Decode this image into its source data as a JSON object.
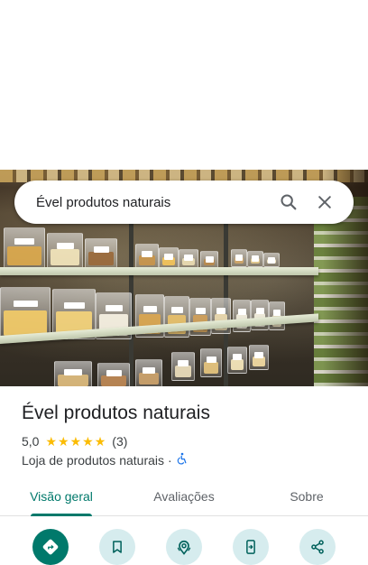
{
  "search": {
    "query": "Ével produtos naturais"
  },
  "place": {
    "name": "Ével produtos naturais",
    "rating": "5,0",
    "stars": 5,
    "review_count": "(3)",
    "category": "Loja de produtos naturais",
    "separator": "·",
    "accessibility_icon": "wheelchair-icon"
  },
  "tabs": [
    {
      "label": "Visão geral",
      "active": true
    },
    {
      "label": "Avaliações",
      "active": false
    },
    {
      "label": "Sobre",
      "active": false
    }
  ],
  "actions": [
    {
      "icon": "directions-icon",
      "primary": true
    },
    {
      "icon": "bookmark-icon",
      "primary": false
    },
    {
      "icon": "nearby-icon",
      "primary": false
    },
    {
      "icon": "send-to-phone-icon",
      "primary": false
    },
    {
      "icon": "share-icon",
      "primary": false
    }
  ],
  "colors": {
    "accent": "#00796b",
    "action_bg": "#d6ecee",
    "star": "#fbbc04"
  }
}
